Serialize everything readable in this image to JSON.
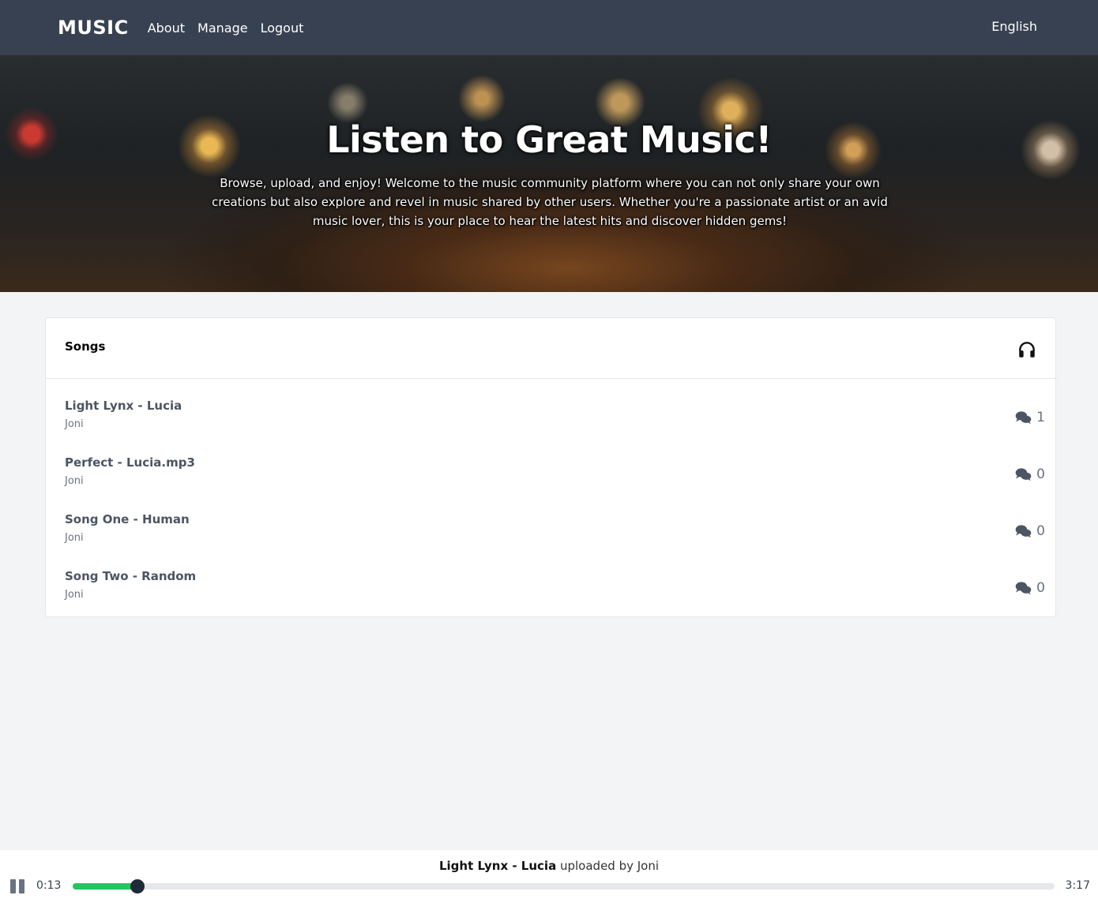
{
  "nav": {
    "brand": "MUSIC",
    "links": [
      "About",
      "Manage",
      "Logout"
    ],
    "language": "English"
  },
  "hero": {
    "title": "Listen to Great Music!",
    "text": "Browse, upload, and enjoy! Welcome to the music community platform where you can not only share your own creations but also explore and revel in music shared by other users. Whether you're a passionate artist or an avid music lover, this is your place to hear the latest hits and discover hidden gems!"
  },
  "songs": {
    "header": "Songs",
    "header_icon": "headphones-icon",
    "comment_icon": "comments-icon",
    "items": [
      {
        "title": "Light Lynx - Lucia",
        "user": "Joni",
        "comments": "1"
      },
      {
        "title": "Perfect - Lucia.mp3",
        "user": "Joni",
        "comments": "0"
      },
      {
        "title": "Song One - Human",
        "user": "Joni",
        "comments": "0"
      },
      {
        "title": "Song Two - Random",
        "user": "Joni",
        "comments": "0"
      }
    ]
  },
  "player": {
    "song_title": "Light Lynx - Lucia",
    "uploaded_by": "uploaded by Joni",
    "current_time": "0:13",
    "duration": "3:17",
    "progress": 0.066,
    "play_state_icon": "pause-icon"
  },
  "colors": {
    "nav_bg": "#374151",
    "progress_fill": "#22c55e",
    "page_bg": "#f3f4f6"
  }
}
